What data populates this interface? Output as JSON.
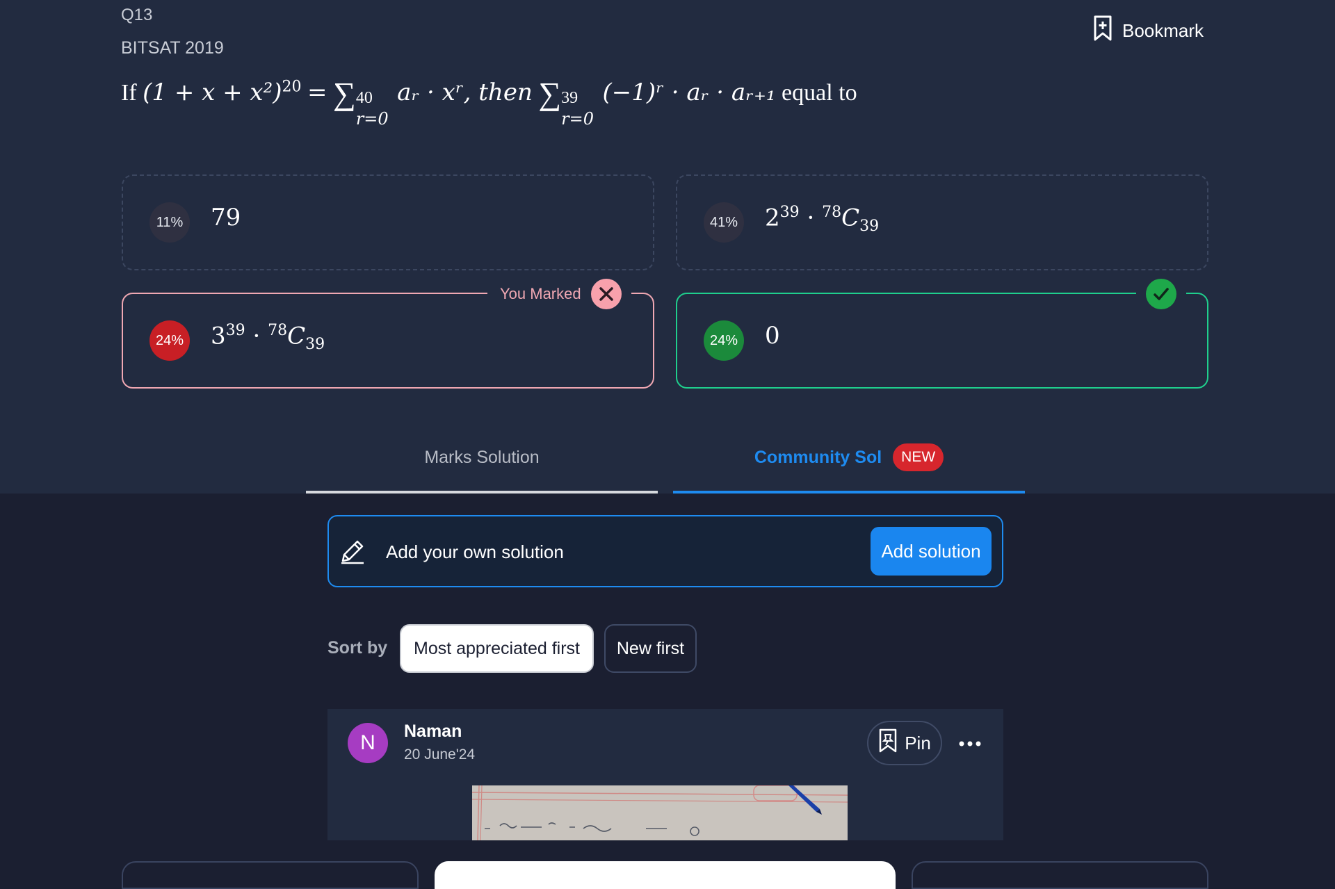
{
  "question": {
    "number": "Q13",
    "exam": "BITSAT 2019",
    "text": {
      "if": "If",
      "lhs_base": "(1 + x + x²)",
      "lhs_exp": "20",
      "eq": "=",
      "sum1_upper": "40",
      "sum1_lower": "r=0",
      "sum1_term": "aᵣ · xʳ, then",
      "sum2_upper": "39",
      "sum2_lower": "r=0",
      "sum2_term": "(−1)ʳ · aᵣ · aᵣ₊₁",
      "tail": "equal to"
    }
  },
  "bookmark": {
    "label": "Bookmark",
    "icon": "bookmark-plus-icon"
  },
  "options": [
    {
      "id": "a",
      "percent": "11%",
      "base": "79",
      "sup": "",
      "mid": "",
      "sup2": "",
      "c": "",
      "sub": ""
    },
    {
      "id": "b",
      "percent": "41%",
      "base": "2",
      "sup": "39",
      "mid": " · ",
      "sup2": "78",
      "c": "C",
      "sub": "39"
    },
    {
      "id": "c",
      "percent": "24%",
      "base": "3",
      "sup": "39",
      "mid": " · ",
      "sup2": "78",
      "c": "C",
      "sub": "39",
      "tag": "You Marked"
    },
    {
      "id": "d",
      "percent": "24%",
      "base": "0",
      "sup": "",
      "mid": "",
      "sup2": "",
      "c": "",
      "sub": ""
    }
  ],
  "tabs": {
    "marks": "Marks Solution",
    "community": "Community Sol",
    "new_badge": "NEW"
  },
  "add_solution": {
    "placeholder": "Add your own solution",
    "button": "Add solution"
  },
  "sort": {
    "label": "Sort by",
    "options": [
      "Most appreciated first",
      "New first"
    ],
    "selected": "Most appreciated first"
  },
  "solution_card": {
    "avatar_letter": "N",
    "author": "Naman",
    "date": "20 June'24",
    "pin_label": "Pin"
  },
  "colors": {
    "background": "#1b1f31",
    "panel": "#222b40",
    "accent": "#1e8bf0",
    "correct": "#1fcf8d",
    "wrong": "#f0a8b3",
    "badge_red": "#d7262d"
  }
}
